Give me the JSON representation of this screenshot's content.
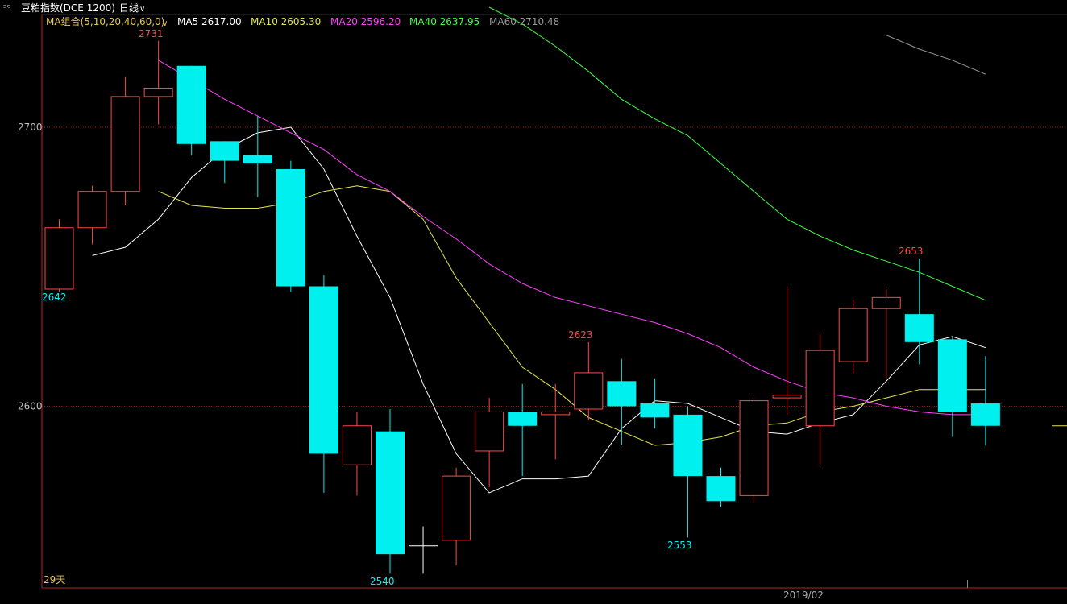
{
  "header": {
    "instrument": "豆粕指数(DCE 1200)",
    "period": "日线",
    "link_icon": "link-icon",
    "dropdown_icon": "chevron-down-icon"
  },
  "ma_legend": [
    {
      "label": "MA组合(5,10,20,40,60,0)",
      "color": "#e6c84e"
    },
    {
      "label": "MA5 2617.00",
      "color": "#ffffff"
    },
    {
      "label": "MA10 2605.30",
      "color": "#e6e64e"
    },
    {
      "label": "MA20 2596.20",
      "color": "#ff40ff"
    },
    {
      "label": "MA40 2637.95",
      "color": "#40ff40"
    },
    {
      "label": "MA60 2710.48",
      "color": "#9a9a9a"
    }
  ],
  "labels": {
    "high_left": "2731",
    "low_left_edge": "2642",
    "mid_high": "2623",
    "mid_low": "2553",
    "right_high": "2653",
    "bottom_low": "2540",
    "days": "29天",
    "x_tick": "2019/02"
  },
  "chart_data": {
    "type": "candlestick",
    "y_ticks": [
      2700,
      2600
    ],
    "colors": {
      "up": "#ff4848",
      "down": "#00f0f0",
      "flat": "#ffffff",
      "grid": "#b01010",
      "frame": "#c02020"
    },
    "candles": [
      {
        "o": 2642,
        "h": 2667,
        "l": 2641,
        "c": 2664
      },
      {
        "o": 2664,
        "h": 2679,
        "l": 2658,
        "c": 2677
      },
      {
        "o": 2677,
        "h": 2718,
        "l": 2672,
        "c": 2711
      },
      {
        "o": 2711,
        "h": 2731,
        "l": 2701,
        "c": 2714
      },
      {
        "o": 2722,
        "h": 2722,
        "l": 2690,
        "c": 2694
      },
      {
        "o": 2695,
        "h": 2695,
        "l": 2680,
        "c": 2688
      },
      {
        "o": 2690,
        "h": 2704,
        "l": 2675,
        "c": 2687
      },
      {
        "o": 2685,
        "h": 2688,
        "l": 2641,
        "c": 2643
      },
      {
        "o": 2643,
        "h": 2647,
        "l": 2569,
        "c": 2583
      },
      {
        "o": 2579,
        "h": 2598,
        "l": 2568,
        "c": 2593
      },
      {
        "o": 2591,
        "h": 2599,
        "l": 2540,
        "c": 2547
      },
      {
        "o": 2550,
        "h": 2557,
        "l": 2540,
        "c": 2550
      },
      {
        "o": 2552,
        "h": 2578,
        "l": 2543,
        "c": 2575
      },
      {
        "o": 2584,
        "h": 2603,
        "l": 2571,
        "c": 2598
      },
      {
        "o": 2598,
        "h": 2608,
        "l": 2575,
        "c": 2593
      },
      {
        "o": 2597,
        "h": 2608,
        "l": 2581,
        "c": 2598
      },
      {
        "o": 2599,
        "h": 2623,
        "l": 2595,
        "c": 2612
      },
      {
        "o": 2609,
        "h": 2617,
        "l": 2586,
        "c": 2600
      },
      {
        "o": 2601,
        "h": 2610,
        "l": 2592,
        "c": 2596
      },
      {
        "o": 2597,
        "h": 2600,
        "l": 2553,
        "c": 2575
      },
      {
        "o": 2575,
        "h": 2578,
        "l": 2564,
        "c": 2566
      },
      {
        "o": 2568,
        "h": 2603,
        "l": 2566,
        "c": 2602
      },
      {
        "o": 2603,
        "h": 2643,
        "l": 2597,
        "c": 2604
      },
      {
        "o": 2593,
        "h": 2626,
        "l": 2579,
        "c": 2620
      },
      {
        "o": 2616,
        "h": 2638,
        "l": 2612,
        "c": 2635
      },
      {
        "o": 2635,
        "h": 2642,
        "l": 2610,
        "c": 2639
      },
      {
        "o": 2633,
        "h": 2653,
        "l": 2615,
        "c": 2623
      },
      {
        "o": 2624,
        "h": 2625,
        "l": 2589,
        "c": 2598
      },
      {
        "o": 2601,
        "h": 2618,
        "l": 2586,
        "c": 2593
      }
    ],
    "ma5": [
      2654,
      2657,
      2667,
      2682,
      2692,
      2698,
      2700,
      2685,
      2661,
      2639,
      2608,
      2583,
      2569,
      2574,
      2574,
      2575,
      2592,
      2602,
      2601,
      2596,
      2591,
      2590,
      2594,
      2597,
      2609,
      2622,
      2625,
      2621
    ],
    "ma10": [
      2677,
      2672,
      2671,
      2671,
      2673,
      2677,
      2679,
      2677,
      2667,
      2646,
      2630,
      2614,
      2606,
      2596,
      2591,
      2586,
      2587,
      2589,
      2593,
      2594,
      2598,
      2600,
      2603,
      2606,
      2606,
      2606
    ],
    "ma20": [
      2724,
      2717,
      2710,
      2704,
      2698,
      2692,
      2683,
      2677,
      2668,
      2660,
      2651,
      2644,
      2639,
      2636,
      2633,
      2630,
      2626,
      2621,
      2614,
      2609,
      2605,
      2603,
      2600,
      2598,
      2597,
      2597
    ],
    "ma40": [
      2743,
      2737,
      2729,
      2720,
      2710,
      2703,
      2697,
      2687,
      2677,
      2667,
      2661,
      2656,
      2652,
      2648,
      2643,
      2638
    ],
    "ma60": [
      2733,
      2728,
      2724,
      2719
    ]
  }
}
